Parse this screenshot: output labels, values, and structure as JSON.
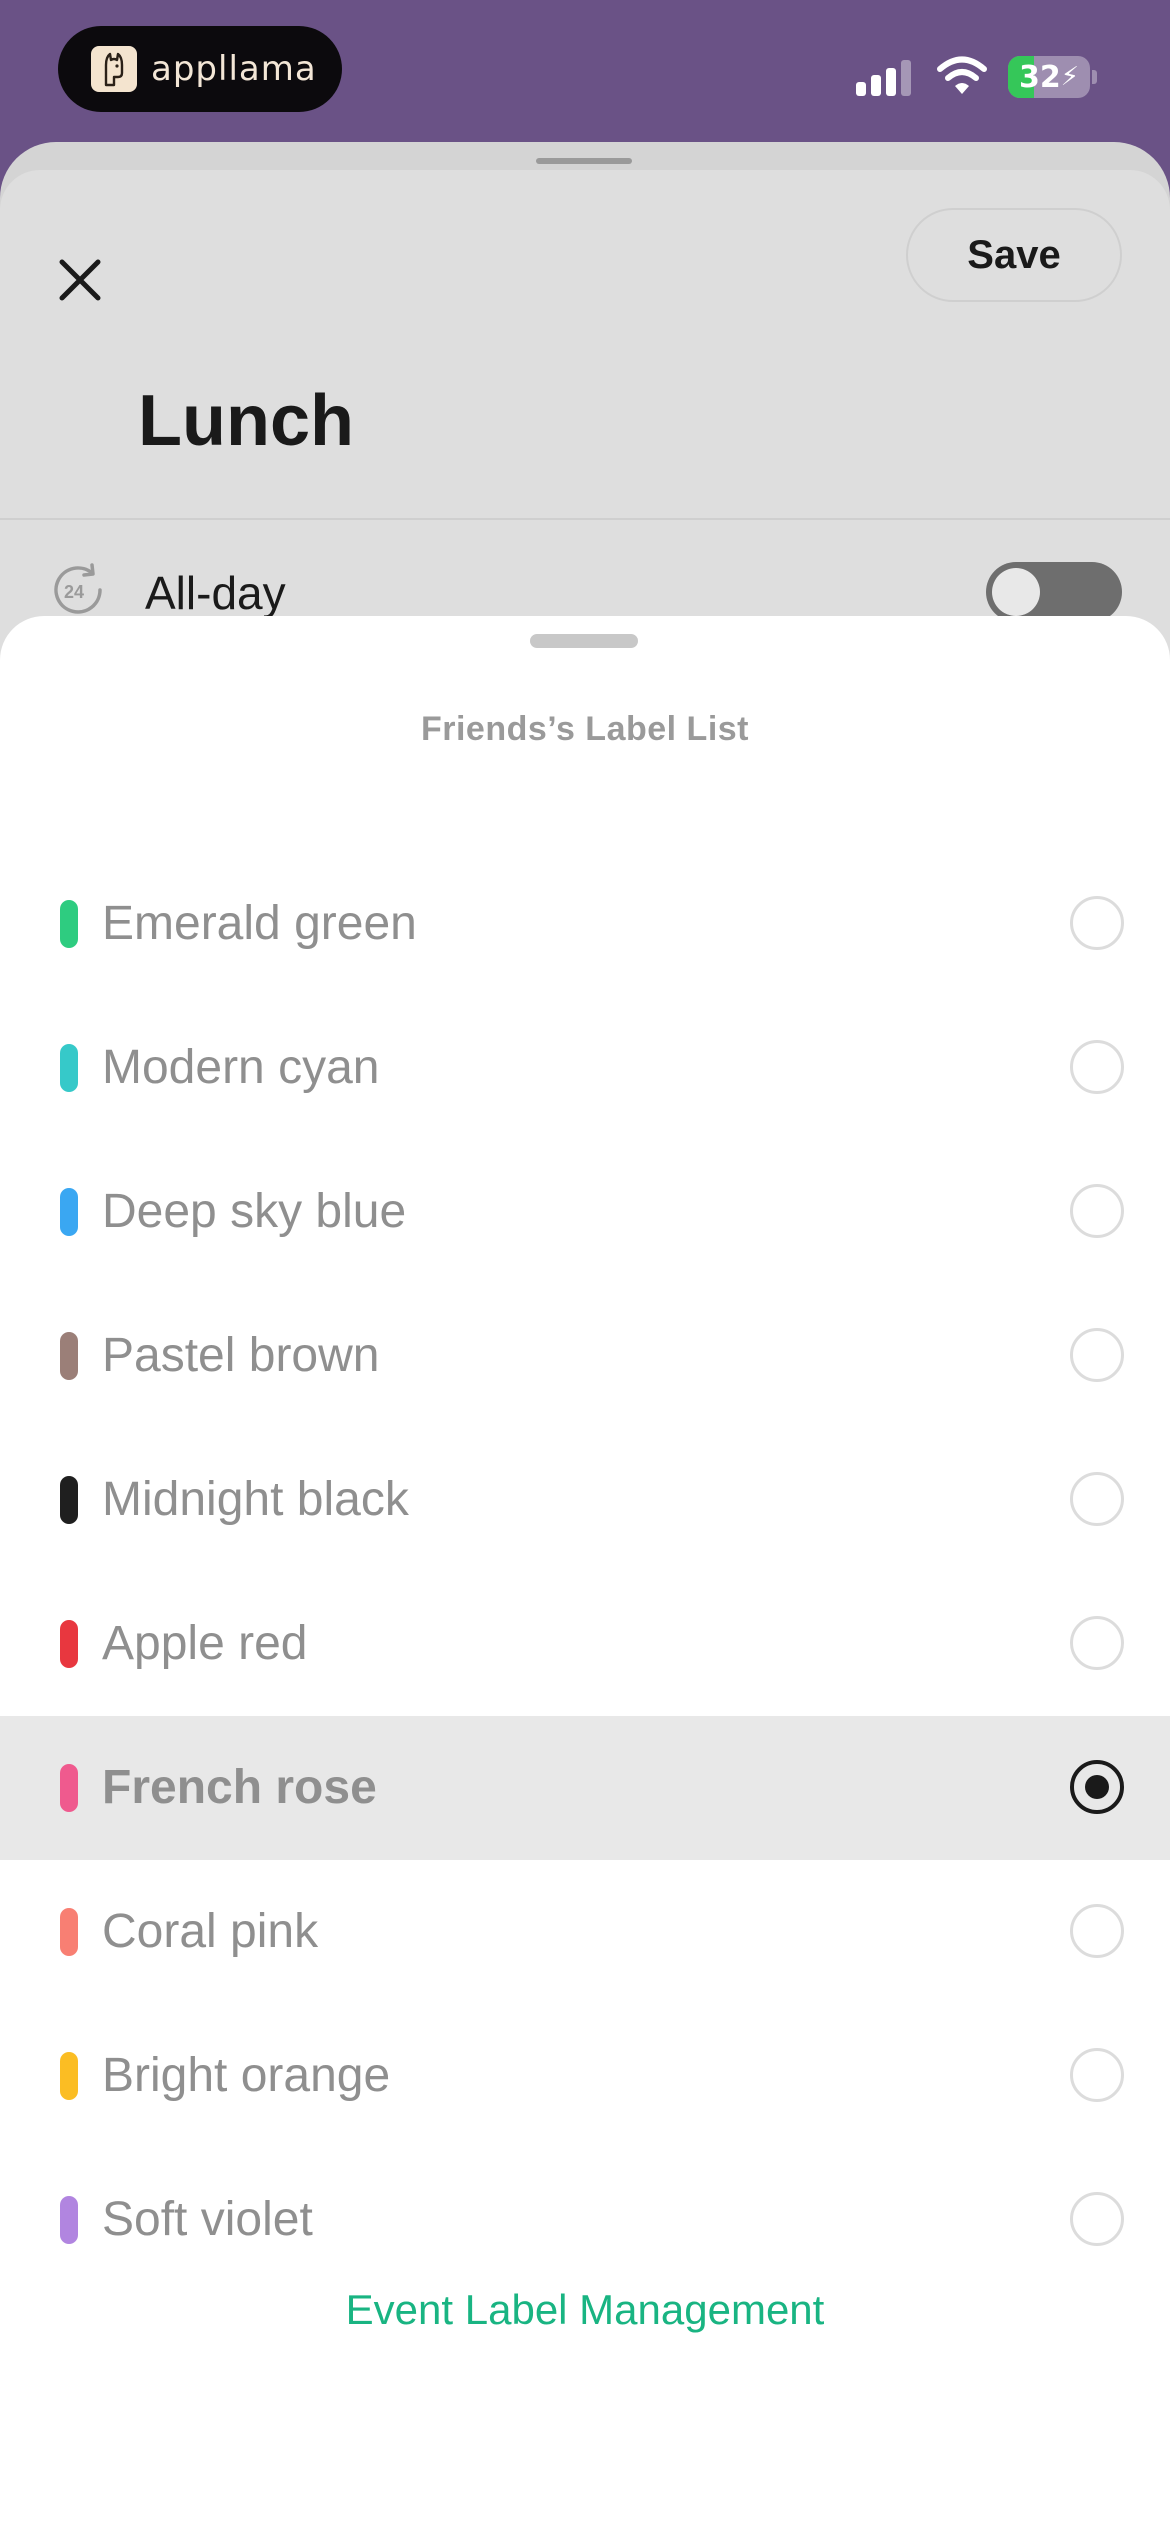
{
  "status_bar": {
    "app_name": "appllama",
    "battery": "32",
    "battery_level_percent": 32,
    "icons": [
      "llama-logo-icon",
      "cellular-signal-icon",
      "wifi-icon",
      "battery-charging-icon"
    ]
  },
  "event": {
    "save_label": "Save",
    "title": "Lunch",
    "allday_label": "All-day",
    "allday_on": false
  },
  "label_sheet": {
    "title": "Friends’s Label List",
    "labels": [
      {
        "name": "Emerald green",
        "color": "#2ecc80",
        "selected": false
      },
      {
        "name": "Modern cyan",
        "color": "#36c9c9",
        "selected": false
      },
      {
        "name": "Deep sky blue",
        "color": "#3aa7f2",
        "selected": false
      },
      {
        "name": "Pastel brown",
        "color": "#9b7f78",
        "selected": false
      },
      {
        "name": "Midnight black",
        "color": "#1f1f1f",
        "selected": false
      },
      {
        "name": "Apple red",
        "color": "#e8373f",
        "selected": false
      },
      {
        "name": "French rose",
        "color": "#ef5a8e",
        "selected": true
      },
      {
        "name": "Coral pink",
        "color": "#f87f73",
        "selected": false
      },
      {
        "name": "Bright orange",
        "color": "#fbbd23",
        "selected": false
      },
      {
        "name": "Soft violet",
        "color": "#b185e0",
        "selected": false
      }
    ],
    "manage_link": "Event Label Management",
    "accent_color": "#19b482"
  }
}
